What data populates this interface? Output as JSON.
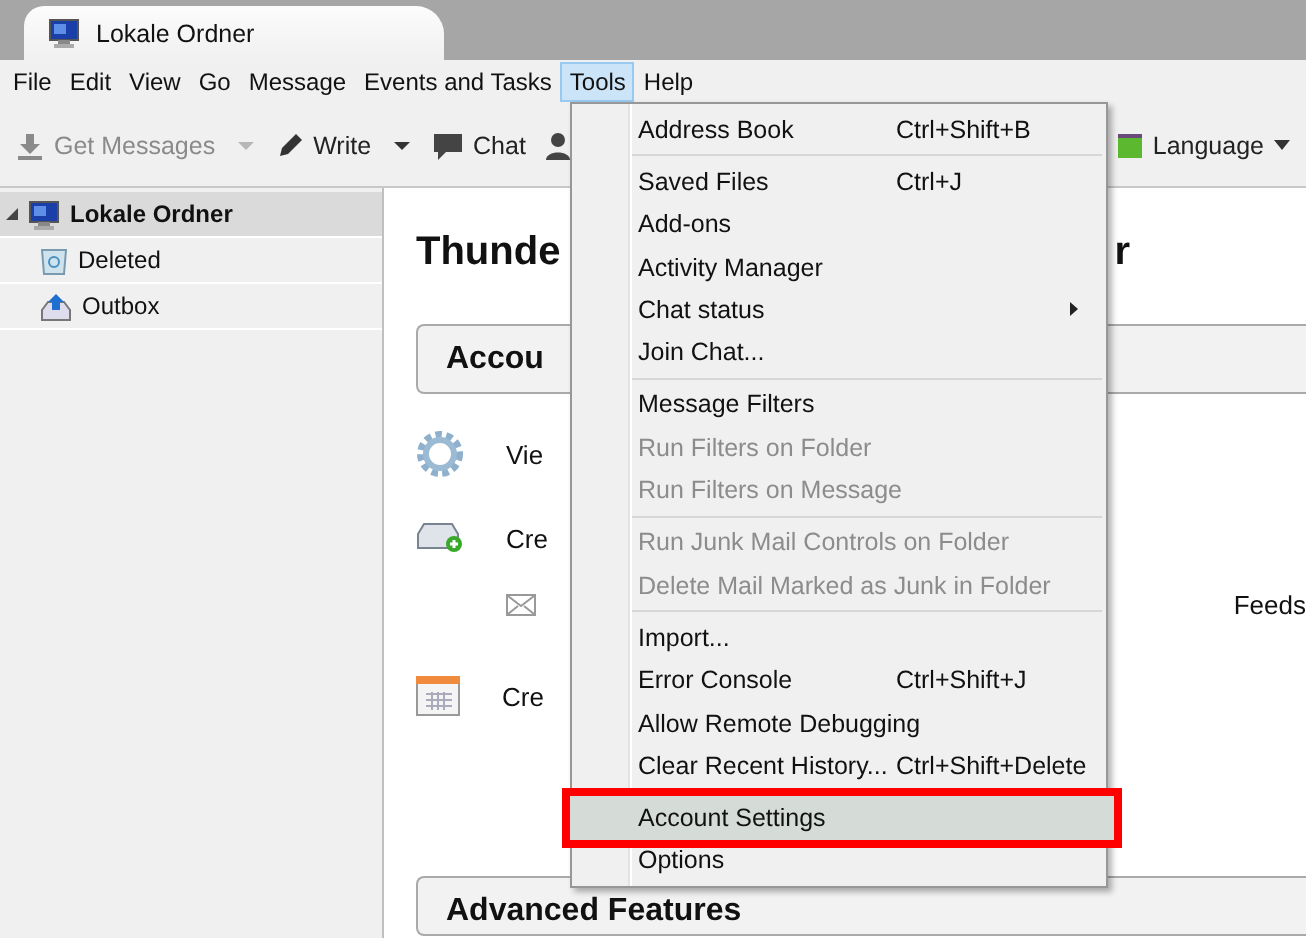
{
  "tab": {
    "title": "Lokale Ordner"
  },
  "menubar": [
    {
      "label": "File",
      "selected": false
    },
    {
      "label": "Edit",
      "selected": false
    },
    {
      "label": "View",
      "selected": false
    },
    {
      "label": "Go",
      "selected": false
    },
    {
      "label": "Message",
      "selected": false
    },
    {
      "label": "Events and Tasks",
      "selected": false
    },
    {
      "label": "Tools",
      "selected": true
    },
    {
      "label": "Help",
      "selected": false
    }
  ],
  "toolbar": {
    "get_messages": {
      "label": "Get Messages",
      "disabled": true
    },
    "write": {
      "label": "Write"
    },
    "chat": {
      "label": "Chat"
    },
    "language": {
      "label": "Language"
    }
  },
  "folders": [
    {
      "name": "Lokale Ordner",
      "selected": true,
      "expanded": true,
      "children": [
        {
          "name": "Deleted",
          "selected": false
        },
        {
          "name": "Outbox",
          "selected": false
        }
      ]
    }
  ],
  "content": {
    "title_start": "Thunde",
    "title_end": "r",
    "accounts_heading": "Accou",
    "view_label": "Vie",
    "create_label": "Cre",
    "feeds_label": "Feeds",
    "calendar_label": "Cre",
    "advanced_heading": "Advanced Features"
  },
  "tools_menu": [
    {
      "kind": "item",
      "label": "Address Book",
      "shortcut": "Ctrl+Shift+B",
      "disabled": false,
      "selected": false
    },
    {
      "kind": "separator"
    },
    {
      "kind": "item",
      "label": "Saved Files",
      "shortcut": "Ctrl+J",
      "disabled": false,
      "selected": false
    },
    {
      "kind": "item",
      "label": "Add-ons",
      "disabled": false,
      "selected": false
    },
    {
      "kind": "item",
      "label": "Activity Manager",
      "disabled": false,
      "selected": false
    },
    {
      "kind": "item",
      "label": "Chat status",
      "submenu": true,
      "disabled": false,
      "selected": false
    },
    {
      "kind": "item",
      "label": "Join Chat...",
      "disabled": false,
      "selected": false
    },
    {
      "kind": "separator"
    },
    {
      "kind": "item",
      "label": "Message Filters",
      "disabled": false,
      "selected": false
    },
    {
      "kind": "item",
      "label": "Run Filters on Folder",
      "disabled": true,
      "selected": false
    },
    {
      "kind": "item",
      "label": "Run Filters on Message",
      "disabled": true,
      "selected": false
    },
    {
      "kind": "separator"
    },
    {
      "kind": "item",
      "label": "Run Junk Mail Controls on Folder",
      "disabled": true,
      "selected": false
    },
    {
      "kind": "item",
      "label": "Delete Mail Marked as Junk in Folder",
      "disabled": true,
      "selected": false
    },
    {
      "kind": "separator"
    },
    {
      "kind": "item",
      "label": "Import...",
      "disabled": false,
      "selected": false
    },
    {
      "kind": "item",
      "label": "Error Console",
      "shortcut": "Ctrl+Shift+J",
      "disabled": false,
      "selected": false
    },
    {
      "kind": "item",
      "label": "Allow Remote Debugging",
      "disabled": false,
      "selected": false
    },
    {
      "kind": "item",
      "label": "Clear Recent History...",
      "shortcut": "Ctrl+Shift+Delete",
      "disabled": false,
      "selected": false
    },
    {
      "kind": "separator"
    },
    {
      "kind": "item",
      "label": "Account Settings",
      "disabled": false,
      "selected": true
    },
    {
      "kind": "item",
      "label": "Options",
      "disabled": false,
      "selected": false
    }
  ]
}
